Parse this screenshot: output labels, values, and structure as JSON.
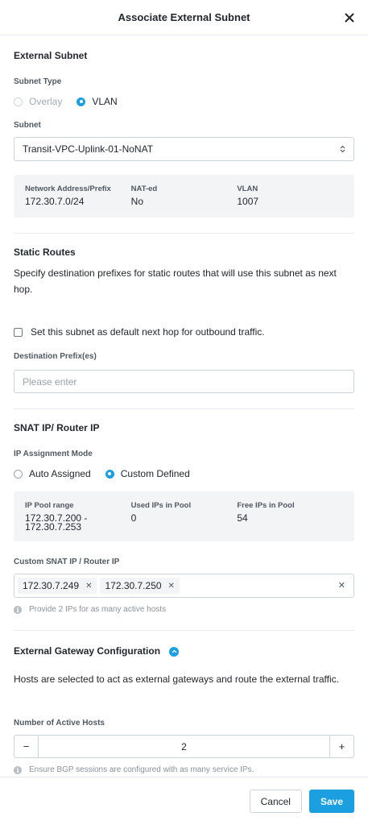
{
  "dialog": {
    "title": "Associate External Subnet"
  },
  "external_subnet": {
    "title": "External Subnet",
    "subnet_type_label": "Subnet Type",
    "subnet_type_options": [
      "Overlay",
      "VLAN"
    ],
    "subnet_type_selected": "VLAN",
    "subnet_label": "Subnet",
    "subnet_value": "Transit-VPC-Uplink-01-NoNAT",
    "info": [
      {
        "label": "Network Address/Prefix",
        "value": "172.30.7.0/24"
      },
      {
        "label": "NAT-ed",
        "value": "No"
      },
      {
        "label": "VLAN",
        "value": "1007"
      }
    ]
  },
  "static_routes": {
    "title": "Static Routes",
    "description": "Specify destination prefixes for static routes that will use this subnet as next hop.",
    "default_next_hop_label": "Set this subnet as default next hop for outbound traffic.",
    "default_next_hop_checked": false,
    "destination_label": "Destination Prefix(es)",
    "destination_placeholder": "Please enter"
  },
  "snat": {
    "title": "SNAT IP/ Router IP",
    "mode_label": "IP Assignment Mode",
    "mode_options": [
      "Auto Assigned",
      "Custom Defined"
    ],
    "mode_selected": "Custom Defined",
    "pool": [
      {
        "label": "IP Pool range",
        "value": "172.30.7.200 - 172.30.7.253"
      },
      {
        "label": "Used IPs in Pool",
        "value": "0"
      },
      {
        "label": "Free IPs in Pool",
        "value": "54"
      }
    ],
    "custom_label": "Custom SNAT IP / Router IP",
    "custom_ips": [
      "172.30.7.249",
      "172.30.7.250"
    ],
    "hint": "Provide 2 IPs for as many active hosts"
  },
  "gateway": {
    "title": "External Gateway Configuration",
    "description": "Hosts are selected to act as external gateways and route the external traffic.",
    "active_hosts_label": "Number of Active Hosts",
    "active_hosts_value": "2",
    "hint": "Ensure BGP sessions are configured with as many service IPs."
  },
  "footer": {
    "cancel_label": "Cancel",
    "save_label": "Save"
  },
  "colors": {
    "accent": "#1b9fe0",
    "info_bg": "#f2f4f6"
  }
}
